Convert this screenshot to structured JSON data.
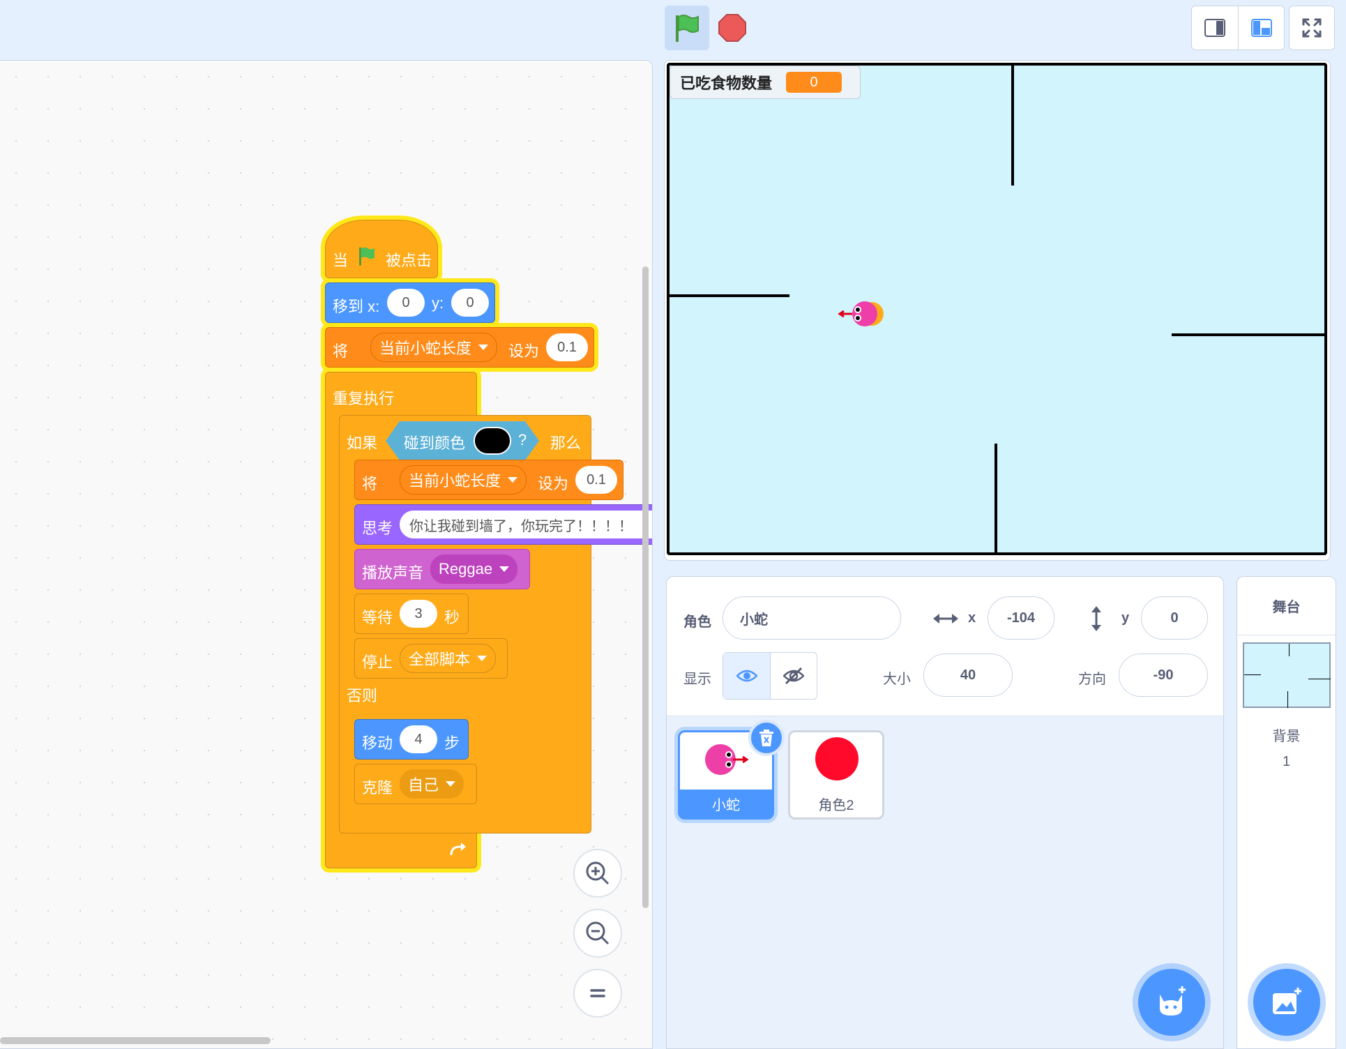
{
  "topbar": {
    "green_flag": "flag-icon",
    "stop": "stop-icon",
    "small_stage": "small-stage-icon",
    "large_stage": "large-stage-icon",
    "fullscreen": "fullscreen-icon"
  },
  "script": {
    "hat": {
      "when": "当",
      "clicked": "被点击"
    },
    "goto": {
      "label": "移到 x:",
      "x": "0",
      "ylabel": "y:",
      "y": "0"
    },
    "set1": {
      "set": "将",
      "var": "当前小蛇长度",
      "to": "设为",
      "value": "0.1"
    },
    "forever": "重复执行",
    "if": {
      "label": "如果",
      "touch": "碰到颜色",
      "q": "?",
      "then": "那么"
    },
    "set2": {
      "set": "将",
      "var": "当前小蛇长度",
      "to": "设为",
      "value": "0.1"
    },
    "think": {
      "label": "思考",
      "text": "你让我碰到墙了，你玩完了！！！！"
    },
    "sound": {
      "label": "播放声音",
      "name": "Reggae"
    },
    "wait": {
      "label": "等待",
      "value": "3",
      "unit": "秒"
    },
    "stop": {
      "label": "停止",
      "option": "全部脚本"
    },
    "else": "否则",
    "move": {
      "label": "移动",
      "value": "4",
      "unit": "步"
    },
    "clone": {
      "label": "克隆",
      "option": "自己"
    }
  },
  "stage": {
    "monitor_label": "已吃食物数量",
    "monitor_value": "0"
  },
  "sprite_info": {
    "sprite_label": "角色",
    "sprite_name": "小蛇",
    "x_label": "x",
    "x": "-104",
    "y_label": "y",
    "y": "0",
    "show_label": "显示",
    "size_label": "大小",
    "size": "40",
    "direction_label": "方向",
    "direction": "-90"
  },
  "sprites": [
    {
      "name": "小蛇",
      "selected": true
    },
    {
      "name": "角色2",
      "selected": false
    }
  ],
  "stage_panel": {
    "title": "舞台",
    "backdrop_label": "背景",
    "backdrop_count": "1"
  },
  "colors": {
    "control": "#ffab19",
    "data": "#ff8c1a",
    "motion": "#4c97ff",
    "looks": "#9966ff",
    "sound": "#cf63cf",
    "sensing": "#5cb1d6",
    "stage_bg": "#d2f4fd"
  }
}
